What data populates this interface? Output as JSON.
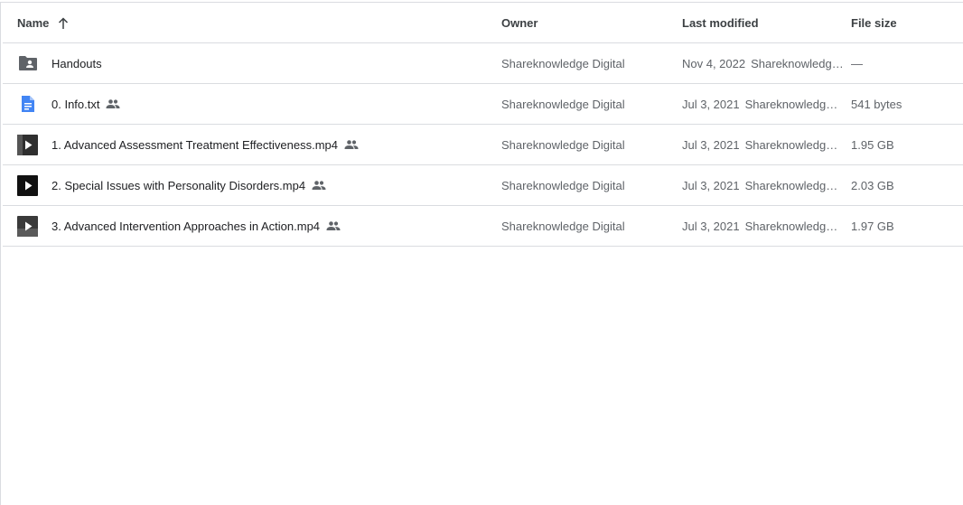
{
  "header": {
    "name": "Name",
    "owner": "Owner",
    "last_modified": "Last modified",
    "file_size": "File size",
    "sort_icon": "arrow-up-icon"
  },
  "rows": [
    {
      "name": "Handouts",
      "type": "shared-folder",
      "shared": false,
      "owner": "Shareknowledge Digital",
      "modified_date": "Nov 4, 2022",
      "modified_by": "Shareknowledge Digital",
      "size": "—"
    },
    {
      "name": "0. Info.txt",
      "type": "document",
      "shared": true,
      "owner": "Shareknowledge Digital",
      "modified_date": "Jul 3, 2021",
      "modified_by": "Shareknowledge Digital",
      "size": "541 bytes"
    },
    {
      "name": "1. Advanced Assessment  Treatment Effectiveness.mp4",
      "type": "video",
      "shared": true,
      "owner": "Shareknowledge Digital",
      "modified_date": "Jul 3, 2021",
      "modified_by": "Shareknowledge Digital",
      "size": "1.95 GB"
    },
    {
      "name": "2. Special Issues with Personality Disorders.mp4",
      "type": "video",
      "shared": true,
      "owner": "Shareknowledge Digital",
      "modified_date": "Jul 3, 2021",
      "modified_by": "Shareknowledge Digital",
      "size": "2.03 GB"
    },
    {
      "name": "3. Advanced Intervention Approaches in Action.mp4",
      "type": "video",
      "shared": true,
      "owner": "Shareknowledge Digital",
      "modified_date": "Jul 3, 2021",
      "modified_by": "Shareknowledge Digital",
      "size": "1.97 GB"
    }
  ],
  "colors": {
    "folder": "#5f6368",
    "document": "#4285f4",
    "divider": "#dadce0",
    "secondary_text": "#5f6368"
  }
}
